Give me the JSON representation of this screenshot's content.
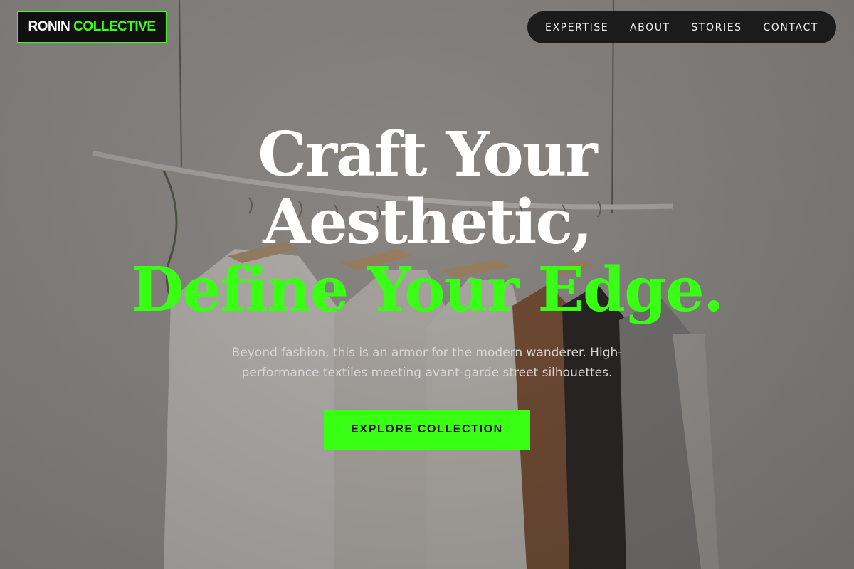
{
  "brand": {
    "name_part1": "RONIN",
    "name_part2": "COLLECTIVE",
    "accent_color": "#39ff14"
  },
  "nav": {
    "items": [
      {
        "label": "EXPERTISE"
      },
      {
        "label": "ABOUT"
      },
      {
        "label": "STORIES"
      },
      {
        "label": "CONTACT"
      }
    ]
  },
  "hero": {
    "headline_line1": "Craft Your",
    "headline_line2": "Aesthetic,",
    "headline_line3": "Define Your Edge.",
    "subtitle": "Beyond fashion, this is an armor for the modern wanderer. High-performance textiles meeting avant-garde street silhouettes.",
    "cta_label": "EXPLORE COLLECTION",
    "background_image": "clothing-rack-photo"
  }
}
